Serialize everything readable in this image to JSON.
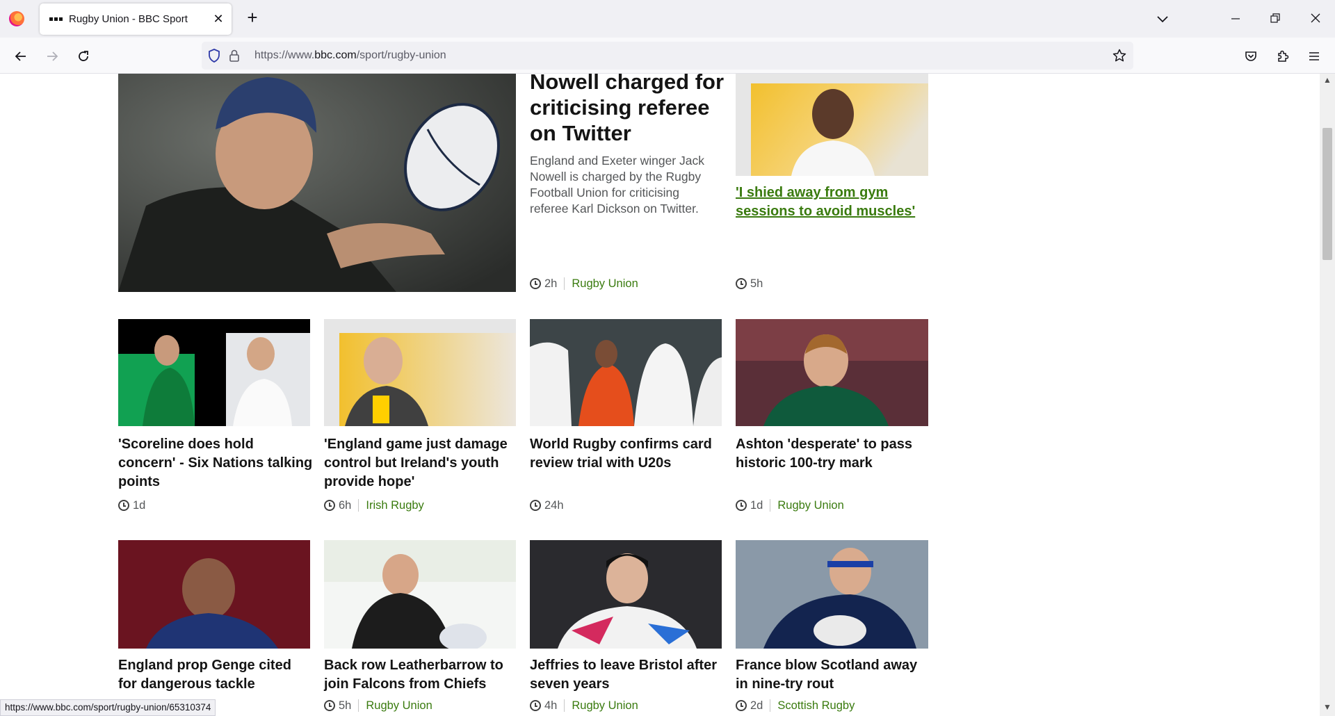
{
  "browser": {
    "tab_title": "Rugby Union - BBC Sport",
    "url_prefix": "https://www.",
    "url_domain": "bbc.com",
    "url_path": "/sport/rugby-union",
    "status_url": "https://www.bbc.com/sport/rugby-union/65310374"
  },
  "lead_story": {
    "headline": "Nowell charged for criticising referee on Twitter",
    "summary": "England and Exeter winger Jack Nowell is charged by the Rugby Football Union for criticising referee Karl Dickson on Twitter.",
    "time": "2h",
    "tag": "Rugby Union"
  },
  "side_story": {
    "headline": "'I shied away from gym sessions to avoid muscles'",
    "time": "5h"
  },
  "stories": [
    {
      "headline": "'Scoreline does hold concern' - Six Nations talking points",
      "time": "1d",
      "tag": ""
    },
    {
      "headline": "'England game just damage control but Ireland's youth provide hope'",
      "time": "6h",
      "tag": "Irish Rugby"
    },
    {
      "headline": "World Rugby confirms card review trial with U20s",
      "time": "24h",
      "tag": ""
    },
    {
      "headline": "Ashton 'desperate' to pass historic 100-try mark",
      "time": "1d",
      "tag": "Rugby Union"
    },
    {
      "headline": "England prop Genge cited for dangerous tackle",
      "time": "",
      "tag": ""
    },
    {
      "headline": "Back row Leatherbarrow to join Falcons from Chiefs",
      "time": "5h",
      "tag": "Rugby Union"
    },
    {
      "headline": "Jeffries to leave Bristol after seven years",
      "time": "4h",
      "tag": "Rugby Union"
    },
    {
      "headline": "France blow Scotland away in nine-try rout",
      "time": "2d",
      "tag": "Scottish Rugby"
    }
  ]
}
